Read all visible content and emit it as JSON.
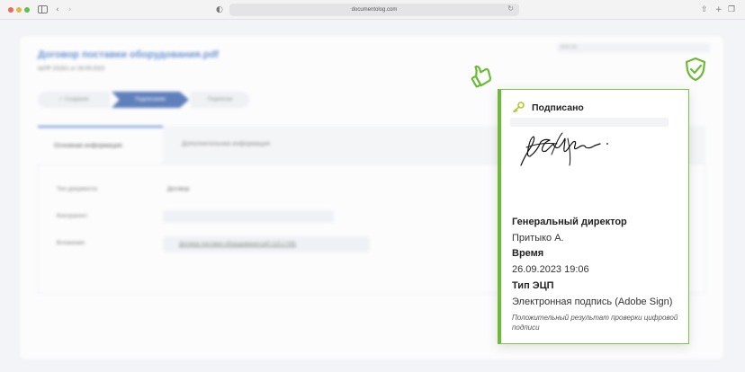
{
  "browser": {
    "url": "documentolog.com"
  },
  "document": {
    "title": "Договор поставки оборудования.pdf",
    "subtitle": "№ПР 2023/1 от 26.09.2023",
    "doc_id_label": "DOC ID:",
    "steps": [
      "✓ Создание",
      "Подписание",
      "Подписан"
    ],
    "tabs": [
      "Основная информация",
      "Дополнительная информация"
    ],
    "fields": {
      "type_label": "Тип документа:",
      "type_value": "Договор",
      "counterparty_label": "Контрагент:",
      "attachments_label": "Вложения:",
      "attachment_file": "Договор поставки оборудования.pdf (115.2 KB)"
    }
  },
  "signature": {
    "status": "Подписано",
    "position": "Генеральный директор",
    "signer": "Притыко А.",
    "time_label": "Время",
    "time": "26.09.2023 19:06",
    "type_label": "Тип ЭЦП",
    "type": "Электронная подпись (Adobe Sign)",
    "note": "Положительный результат проверки цифровой подписи"
  },
  "colors": {
    "accent_green": "#6dbb35",
    "brand_blue": "#3d73c4"
  }
}
